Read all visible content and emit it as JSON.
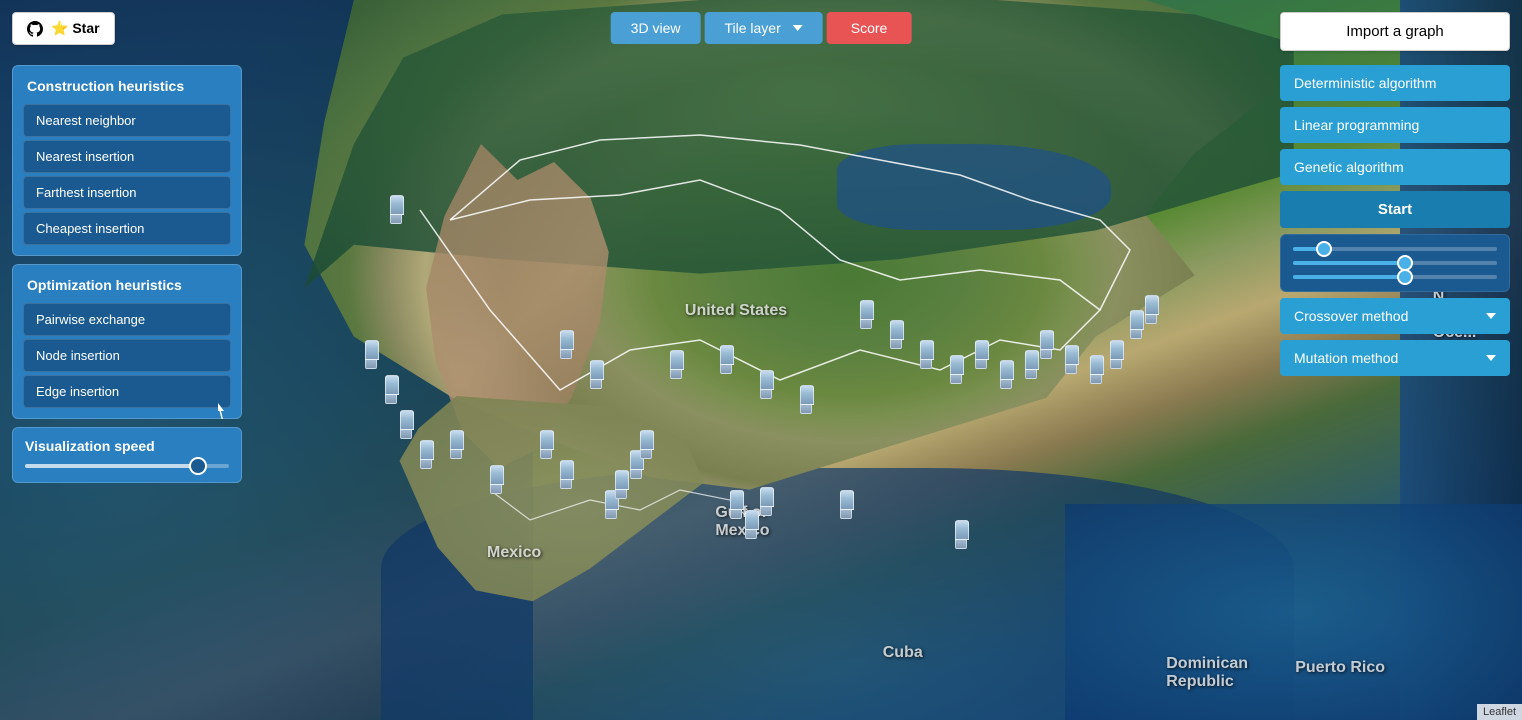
{
  "header": {
    "github_star_label": "⭐ Star",
    "btn_3d_view": "3D view",
    "btn_tile_layer": "Tile layer",
    "btn_score": "Score",
    "btn_import_graph": "Import a graph"
  },
  "left_panel": {
    "construction_title": "Construction heuristics",
    "construction_items": [
      {
        "label": "Nearest neighbor"
      },
      {
        "label": "Nearest insertion"
      },
      {
        "label": "Farthest insertion"
      },
      {
        "label": "Cheapest insertion"
      }
    ],
    "optimization_title": "Optimization heuristics",
    "optimization_items": [
      {
        "label": "Pairwise exchange"
      },
      {
        "label": "Node insertion"
      },
      {
        "label": "Edge insertion"
      }
    ],
    "speed_title": "Visualization speed"
  },
  "right_panel": {
    "deterministic_label": "Deterministic algorithm",
    "linear_programming_label": "Linear programming",
    "genetic_algorithm_label": "Genetic algorithm",
    "start_label": "Start",
    "crossover_method_label": "Crossover method",
    "mutation_method_label": "Mutation method"
  },
  "map": {
    "label_us": "United States",
    "label_mexico": "Mexico",
    "label_gulf": "Gulf of\nMexico",
    "label_cuba": "Cuba",
    "label_dominican": "Dominican\nRepublic",
    "label_puerto_rico": "Puerto Rico",
    "label_atlantic": "N.\nAtla\nOce...",
    "attribution": "Leaflet"
  }
}
